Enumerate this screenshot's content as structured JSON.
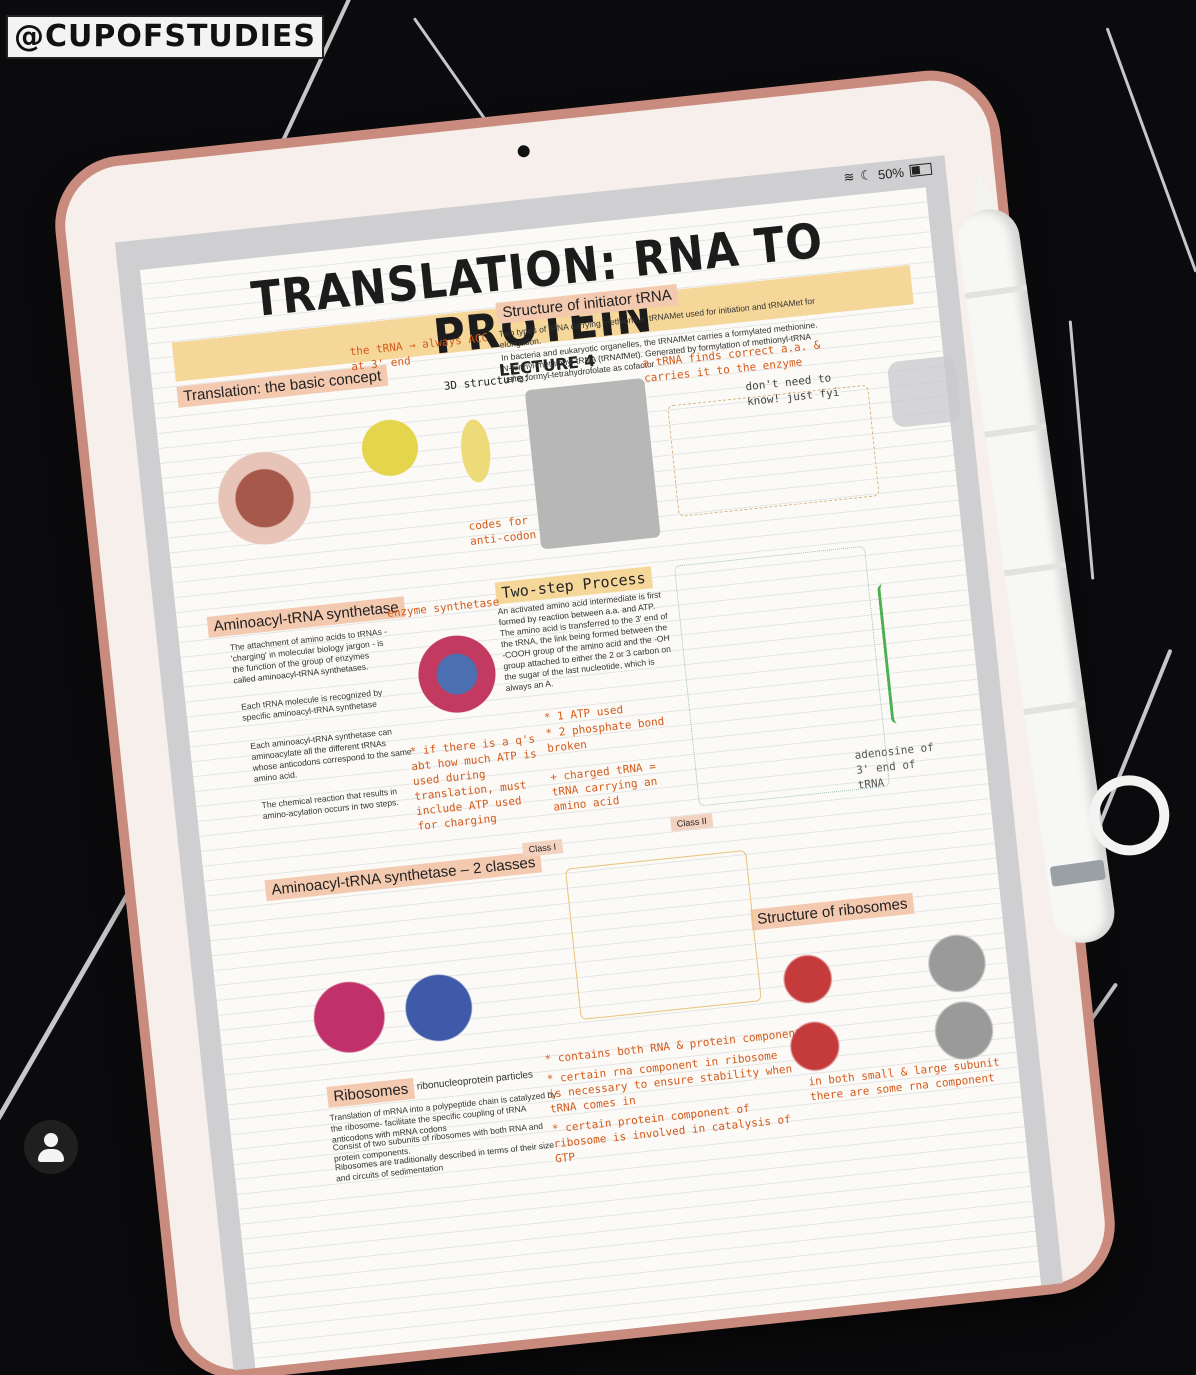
{
  "watermark": "@CUPOFSTUDIES",
  "status": {
    "battery": "50%"
  },
  "note": {
    "title": "TRANSLATION: RNA TO PROTEIN",
    "subtitle": "LECTURE 4",
    "headings": [
      "Translation: the basic concept",
      "Structure of initiator tRNA",
      "Aminoacyl-tRNA synthetase",
      "Two-step Process",
      "Aminoacyl-tRNA synthetase – 2 classes",
      "Structure of ribosomes",
      "Ribosomes"
    ],
    "text_blocks": [
      "Two types of tRNA carrying methionine. tRNAMet used for initiation and tRNAMet for elongation.",
      "In bacteria and eukaryotic organelles, the tRNAfMet carries a formylated methionine. N-formyl-methionyl-tRNA (tRNAfMet). Generated by formylation of methionyl-tRNA using formyl-tetrahydrofolate as cofactor",
      "The attachment of amino acids to tRNAs - 'charging' in molecular biology jargon - is the function of the group of enzymes called aminoacyl-tRNA synthetases.",
      "Each tRNA molecule is recognized by specific aminoacyl-tRNA synthetase",
      "Each aminoacyl-tRNA synthetase can aminoacylate all the different tRNAs whose anticodons correspond to the same amino acid.",
      "The chemical reaction that results in amino-acylation occurs in two steps.",
      "An activated amino acid intermediate is first formed by reaction between a.a. and ATP. The amino acid is transferred to the 3' end of the tRNA, the link being formed between the -COOH group of the amino acid and the -OH group attached to either the 2 or 3 carbon on the sugar of the last nucleotide, which is always an A.",
      "Translation of mRNA into a polypeptide chain is catalyzed by the ribosome- facilitate the specific coupling of tRNA anticodons with mRNA codons",
      "Consist of two subunits of ribosomes with both RNA and protein components.",
      "Ribosomes are traditionally described in terms of their size and circuits of sedimentation"
    ],
    "handwritten": [
      "the tRNA → always ACC at 3' end",
      "3D structure:",
      "codes for anti-codon",
      "a tRNA finds correct a.a. & carries it to the enzyme",
      "don't need to know! just fyi",
      "enzyme synthetase",
      "* if there is a q's abt how much ATP is used during translation, must include ATP used for charging",
      "* 1 ATP used",
      "* 2 phosphate bond broken",
      "+ charged tRNA = tRNA carrying an amino acid",
      "adenosine of 3' end of tRNA",
      "* contains both RNA & protein component",
      "* certain rna component in ribosome is necessary to ensure stability when tRNA comes in",
      "* certain protein component of ribosome is involved in catalysis of GTP",
      "in both small & large subunit there are some rna component"
    ],
    "labels": {
      "class1": "Class I",
      "class2": "Class II",
      "ribosomes_sub": "ribonucleoprotein particles"
    }
  }
}
